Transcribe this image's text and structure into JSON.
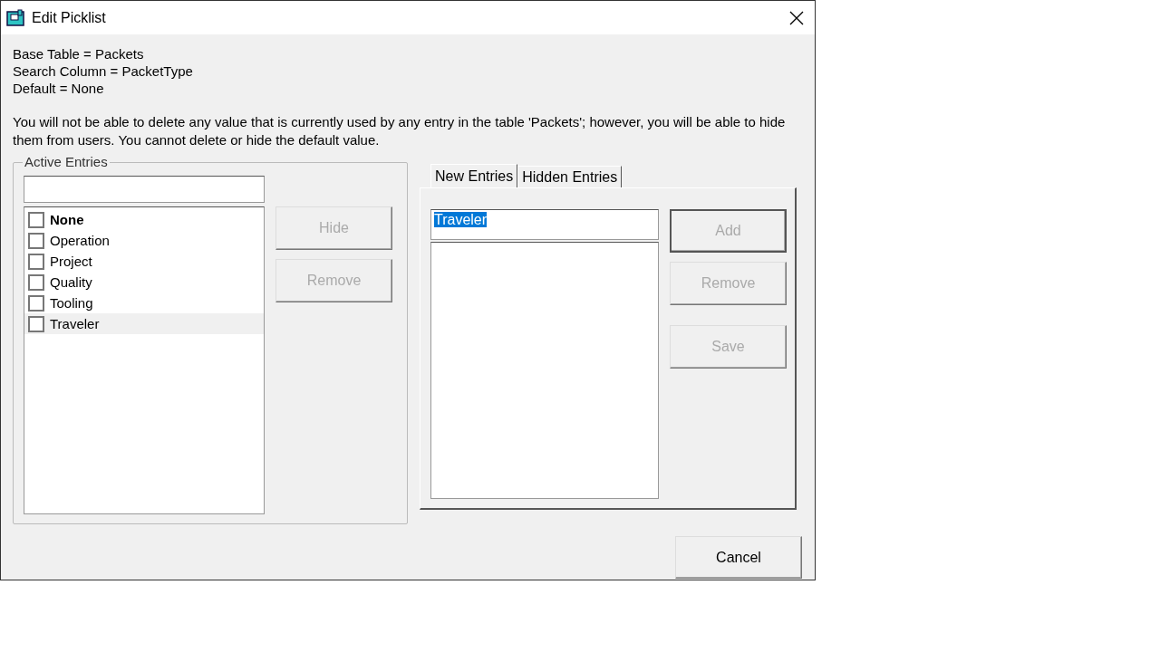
{
  "window": {
    "title": "Edit Picklist"
  },
  "info_lines": [
    "Base Table = Packets",
    "Search Column = PacketType",
    "Default = None"
  ],
  "note": "You will not be able to delete any value that is currently used by any entry in the table 'Packets'; however, you will be able to hide them from users. You cannot delete or hide the default value.",
  "active_entries": {
    "label": "Active Entries",
    "items": [
      {
        "label": "None",
        "checked": false,
        "selected": false,
        "default": true
      },
      {
        "label": "Operation",
        "checked": false,
        "selected": false,
        "default": false
      },
      {
        "label": "Project",
        "checked": false,
        "selected": false,
        "default": false
      },
      {
        "label": "Quality",
        "checked": false,
        "selected": false,
        "default": false
      },
      {
        "label": "Tooling",
        "checked": false,
        "selected": false,
        "default": false
      },
      {
        "label": "Traveler",
        "checked": false,
        "selected": true,
        "default": false
      }
    ],
    "buttons": [
      {
        "label": "Hide",
        "disabled": true
      },
      {
        "label": "Remove",
        "disabled": true
      }
    ]
  },
  "tabs": [
    {
      "label": "New Entries",
      "selected": true
    },
    {
      "label": "Hidden Entries",
      "selected": false
    }
  ],
  "new_entry": {
    "value": "Traveler",
    "text_selected": true
  },
  "tab_buttons": [
    {
      "label": "Add",
      "disabled": true
    },
    {
      "label": "Remove",
      "disabled": true
    },
    {
      "label": "Save",
      "disabled": true
    }
  ],
  "footer_buttons": [
    {
      "label": "Cancel",
      "disabled": false
    }
  ]
}
